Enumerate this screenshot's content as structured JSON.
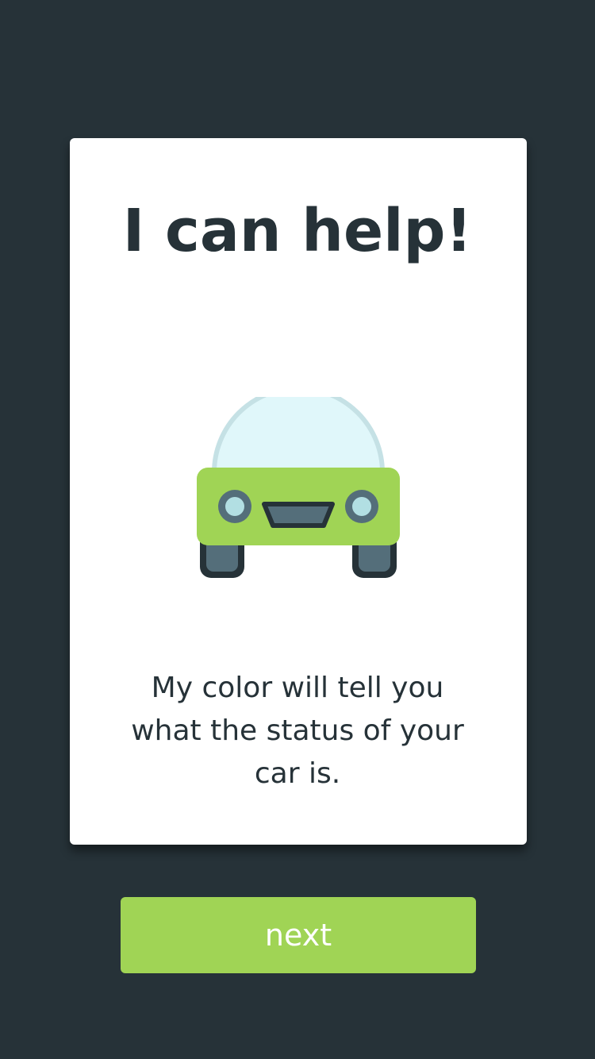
{
  "card": {
    "title": "I can help!",
    "message": "My color will tell you what the status of your car is."
  },
  "illustration": {
    "icon": "car-icon",
    "colors": {
      "body": "#a0d455",
      "windshield": "#e0f7fa",
      "windshield_outline": "#c5e1e5",
      "headlight": "#b2dfe3",
      "headlight_ring": "#546e7a",
      "grille": "#546e7a",
      "outline": "#263238",
      "wheel": "#546e7a"
    }
  },
  "actions": {
    "next_label": "next"
  },
  "theme": {
    "background": "#263238",
    "card_background": "#ffffff",
    "accent": "#a0d455",
    "text": "#263238"
  }
}
